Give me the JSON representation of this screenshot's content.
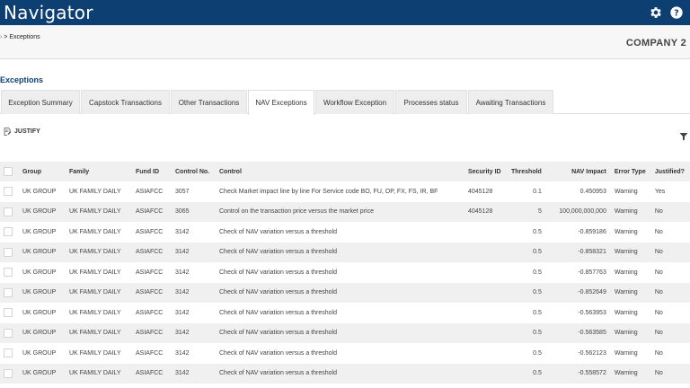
{
  "app": {
    "title": "Navigator"
  },
  "breadcrumb": {
    "home": "›",
    "separator": ">",
    "current": "Exceptions"
  },
  "company": "COMPANY 2",
  "section_title": "Exceptions",
  "tabs": [
    {
      "label": "Exception Summary",
      "active": false
    },
    {
      "label": "Capstock Transactions",
      "active": false
    },
    {
      "label": "Other Transactions",
      "active": false
    },
    {
      "label": "NAV Exceptions",
      "active": true
    },
    {
      "label": "Workflow Exception",
      "active": false
    },
    {
      "label": "Processes status",
      "active": false
    },
    {
      "label": "Awaiting Transactions",
      "active": false
    }
  ],
  "toolbar": {
    "justify_label": "JUSTIFY"
  },
  "table": {
    "columns": [
      "Group",
      "Family",
      "Fund ID",
      "Control No.",
      "Control",
      "Security ID",
      "Threshold",
      "NAV Impact",
      "Error Type",
      "Justified?"
    ],
    "rows": [
      [
        "UK GROUP",
        "UK FAMILY DAILY",
        "ASIAFCC",
        "3057",
        "Check Market impact line by line For Service code BO, FU, OP, FX, FS, IR, BF",
        "4045128",
        "0.1",
        "0.450953",
        "Warning",
        "Yes"
      ],
      [
        "UK GROUP",
        "UK FAMILY DAILY",
        "ASIAFCC",
        "3065",
        "Control on the transaction price versus the market price",
        "4045128",
        "5",
        "100,000,000,000",
        "Warning",
        "No"
      ],
      [
        "UK GROUP",
        "UK FAMILY DAILY",
        "ASIAFCC",
        "3142",
        "Check of NAV variation versus a threshold",
        "",
        "0.5",
        "-0.859186",
        "Warning",
        "No"
      ],
      [
        "UK GROUP",
        "UK FAMILY DAILY",
        "ASIAFCC",
        "3142",
        "Check of NAV variation versus a threshold",
        "",
        "0.5",
        "-0.858321",
        "Warning",
        "No"
      ],
      [
        "UK GROUP",
        "UK FAMILY DAILY",
        "ASIAFCC",
        "3142",
        "Check of NAV variation versus a threshold",
        "",
        "0.5",
        "-0.857763",
        "Warning",
        "No"
      ],
      [
        "UK GROUP",
        "UK FAMILY DAILY",
        "ASIAFCC",
        "3142",
        "Check of NAV variation versus a threshold",
        "",
        "0.5",
        "-0.852649",
        "Warning",
        "No"
      ],
      [
        "UK GROUP",
        "UK FAMILY DAILY",
        "ASIAFCC",
        "3142",
        "Check of NAV variation versus a threshold",
        "",
        "0.5",
        "-0.563953",
        "Warning",
        "No"
      ],
      [
        "UK GROUP",
        "UK FAMILY DAILY",
        "ASIAFCC",
        "3142",
        "Check of NAV variation versus a threshold",
        "",
        "0.5",
        "-0.563585",
        "Warning",
        "No"
      ],
      [
        "UK GROUP",
        "UK FAMILY DAILY",
        "ASIAFCC",
        "3142",
        "Check of NAV variation versus a threshold",
        "",
        "0.5",
        "-0.562123",
        "Warning",
        "No"
      ],
      [
        "UK GROUP",
        "UK FAMILY DAILY",
        "ASIAFCC",
        "3142",
        "Check of NAV variation versus a threshold",
        "",
        "0.5",
        "-0.558572",
        "Warning",
        "No"
      ]
    ]
  },
  "icons": {
    "settings": "gear-icon",
    "help": "help-icon",
    "justify": "edit-note-icon",
    "filter": "filter-icon"
  },
  "colors": {
    "header_bg": "#0d3f73",
    "accent": "#0d3f73"
  }
}
